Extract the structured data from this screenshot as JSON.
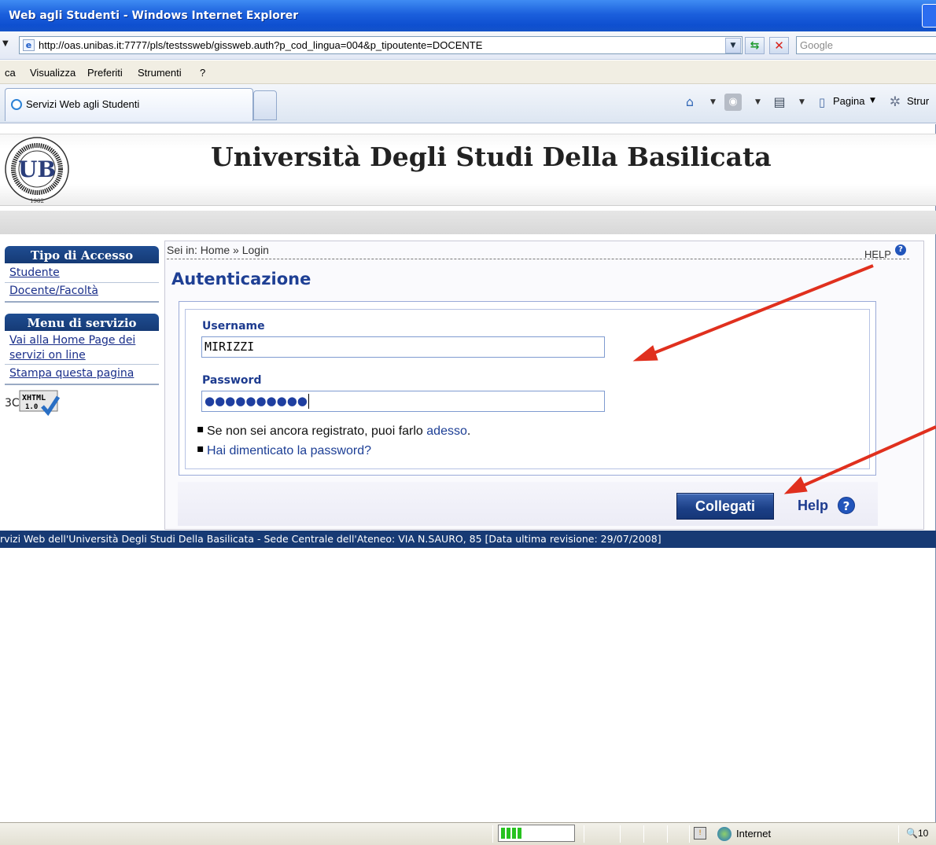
{
  "window": {
    "title": "Web agli Studenti - Windows Internet Explorer",
    "url": "http://oas.unibas.it:7777/pls/testssweb/gissweb.auth?p_cod_lingua=004&p_tipoutente=DOCENTE",
    "search_placeholder": "Google"
  },
  "menu": [
    "ca",
    "Visualizza",
    "Preferiti",
    "Strumenti",
    "?"
  ],
  "tabs": {
    "active_label": "Servizi Web agli Studenti"
  },
  "toolbar": {
    "page_label": "Pagina",
    "tools_label": "Strur"
  },
  "header": {
    "university_name": "Università Degli Studi Della Basilicata"
  },
  "sidebar": {
    "access_title": "Tipo di Accesso",
    "access_items": [
      "Studente",
      "Docente/Facoltà"
    ],
    "service_title": "Menu di servizio",
    "service_items": [
      "Vai alla Home Page dei servizi on line",
      "Stampa questa pagina"
    ],
    "w3c_badge": {
      "w3c": "3C",
      "xhtml": "XHTML",
      "version": "1.0"
    }
  },
  "content": {
    "breadcrumb": "Sei in: Home » Login",
    "help_top": "HELP",
    "title": "Autenticazione",
    "username_label": "Username",
    "username_value": "MIRIZZI",
    "password_label": "Password",
    "password_mask": "●●●●●●●●●●",
    "register_text": "Se non sei ancora registrato, puoi farlo ",
    "register_link": "adesso",
    "register_end": ".",
    "forgot_link": "Hai dimenticato la password?",
    "login_button": "Collegati",
    "help_bottom": "Help"
  },
  "footer": {
    "text": "rvizi Web dell'Università Degli Studi Della Basilicata - Sede Centrale dell'Ateneo: VIA N.SAURO, 85 [Data ultima revisione: 29/07/2008]"
  },
  "statusbar": {
    "zone": "Internet",
    "zoom": "10"
  },
  "colors": {
    "brand_blue": "#173a74",
    "link_blue": "#1c3e95",
    "annotation_red": "#e0301e"
  }
}
